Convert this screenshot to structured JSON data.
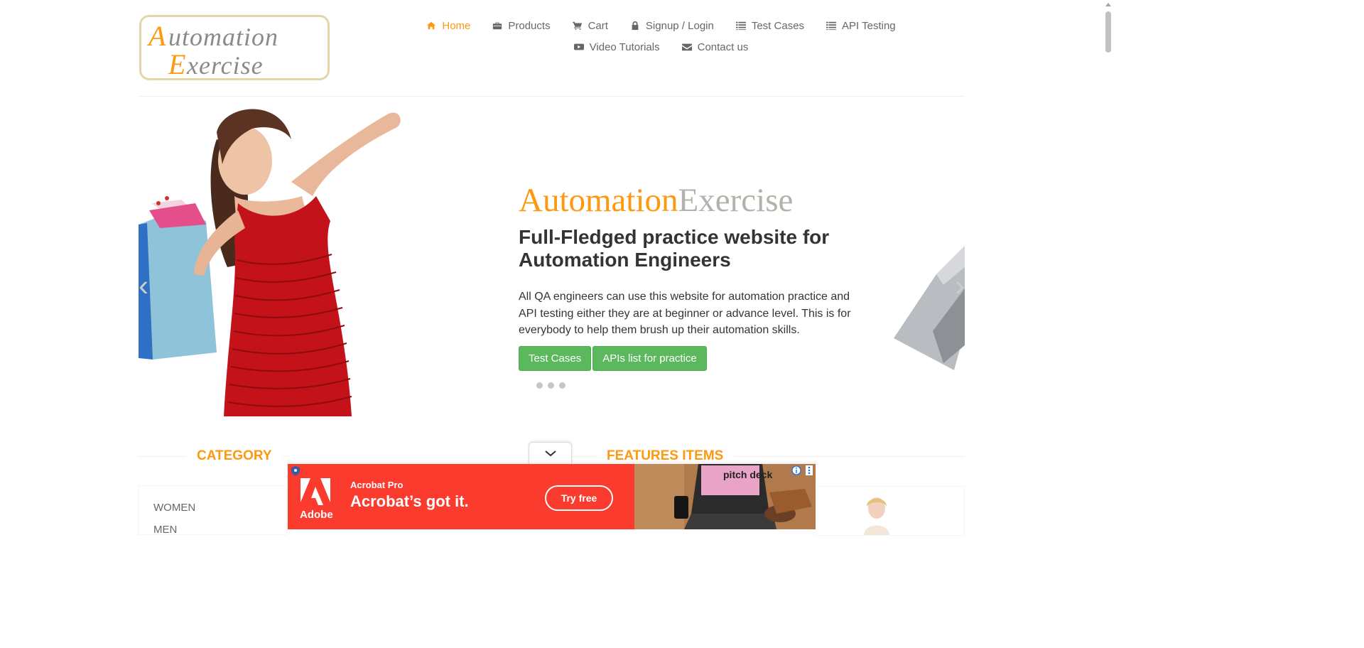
{
  "logo": {
    "line1": "Automation",
    "line2": "Exercise"
  },
  "nav": {
    "row1": [
      {
        "label": "Home",
        "icon": "home-icon",
        "active": true
      },
      {
        "label": "Products",
        "icon": "briefcase-icon"
      },
      {
        "label": "Cart",
        "icon": "cart-icon"
      },
      {
        "label": "Signup / Login",
        "icon": "lock-icon"
      },
      {
        "label": "Test Cases",
        "icon": "list-icon"
      },
      {
        "label": "API Testing",
        "icon": "list-icon"
      }
    ],
    "row2": [
      {
        "label": "Video Tutorials",
        "icon": "youtube-play-icon"
      },
      {
        "label": "Contact us",
        "icon": "envelope-icon"
      }
    ]
  },
  "slider": {
    "brand_part1": "Automation",
    "brand_part2": "Exercise",
    "heading": "Full-Fledged practice website for Automation Engineers",
    "paragraph": "All QA engineers can use this website for automation practice and API testing either they are at beginner or advance level. This is for everybody to help them brush up their automation skills.",
    "btn_test_cases": "Test Cases",
    "btn_apis": "APIs list for practice",
    "arrow_left": "‹",
    "arrow_right": "›",
    "active_dot": 1
  },
  "sections": {
    "category_title": "CATEGORY",
    "features_title": "FEATURES ITEMS",
    "categories": [
      "WOMEN",
      "MEN"
    ]
  },
  "ad": {
    "brand": "Acrobat Pro",
    "headline": "Acrobat’s got it.",
    "cta": "Try free",
    "adobe_wordmark": "Adobe",
    "sticker": "pitch deck"
  },
  "colors": {
    "accent": "#fe980f",
    "button_green": "#5cb85c",
    "ad_red": "#fa3b2e",
    "text_dark": "#363432",
    "text_muted": "#696763"
  }
}
